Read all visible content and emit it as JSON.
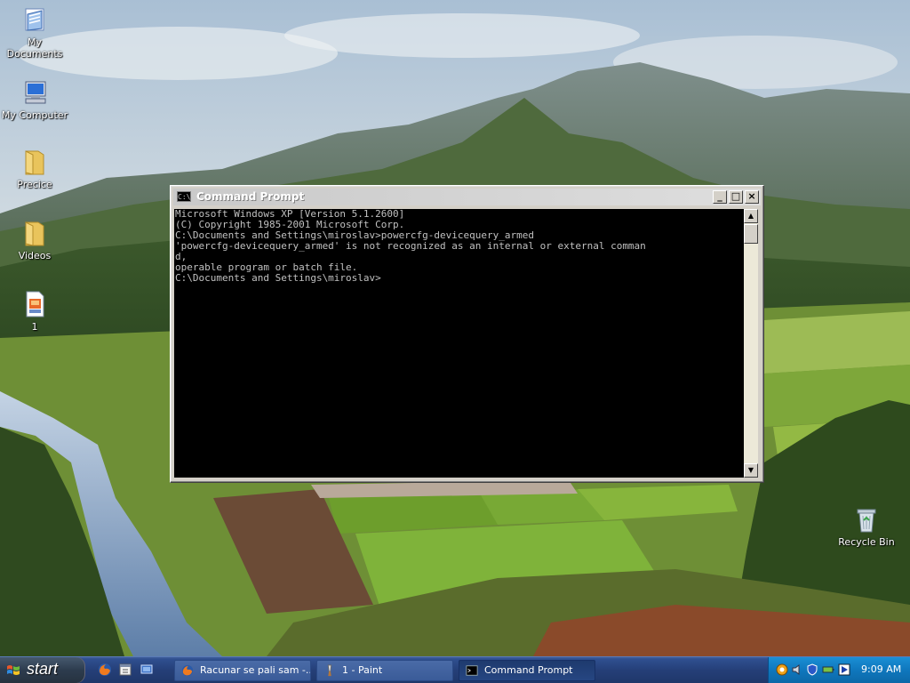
{
  "desktop": {
    "icons": [
      {
        "label": "My Documents",
        "icon": "my-documents-icon"
      },
      {
        "label": "My Computer",
        "icon": "my-computer-icon"
      },
      {
        "label": "Precice",
        "icon": "folder-icon"
      },
      {
        "label": "Videos",
        "icon": "folder-icon"
      },
      {
        "label": "1",
        "icon": "image-file-icon"
      },
      {
        "label": "Recycle Bin",
        "icon": "recycle-bin-icon"
      }
    ]
  },
  "cmd_window": {
    "title": "Command Prompt",
    "title_icon_text": "C:\\",
    "buttons": {
      "minimize": "_",
      "maximize": "□",
      "close": "×"
    },
    "lines": [
      "Microsoft Windows XP [Version 5.1.2600]",
      "(C) Copyright 1985-2001 Microsoft Corp.",
      "",
      "C:\\Documents and Settings\\miroslav>powercfg-devicequery_armed",
      "'powercfg-devicequery_armed' is not recognized as an internal or external comman",
      "d,",
      "operable program or batch file.",
      "",
      "C:\\Documents and Settings\\miroslav>"
    ],
    "colors": {
      "background": "#000000",
      "text": "#c0c0c0"
    }
  },
  "taskbar": {
    "start_label": "start",
    "quick_launch": [
      "firefox-icon",
      "calendar-icon",
      "show-desktop-icon"
    ],
    "tasks": [
      {
        "label": "Racunar se pali sam -...",
        "icon": "firefox-icon",
        "active": false
      },
      {
        "label": "1 - Paint",
        "icon": "paint-icon",
        "active": false
      },
      {
        "label": "Command Prompt",
        "icon": "cmd-icon",
        "active": true
      }
    ],
    "tray_icons": [
      "network-icon",
      "speaker-icon",
      "security-shield-icon",
      "battery-icon",
      "media-icon"
    ],
    "clock": "9:09 AM"
  }
}
